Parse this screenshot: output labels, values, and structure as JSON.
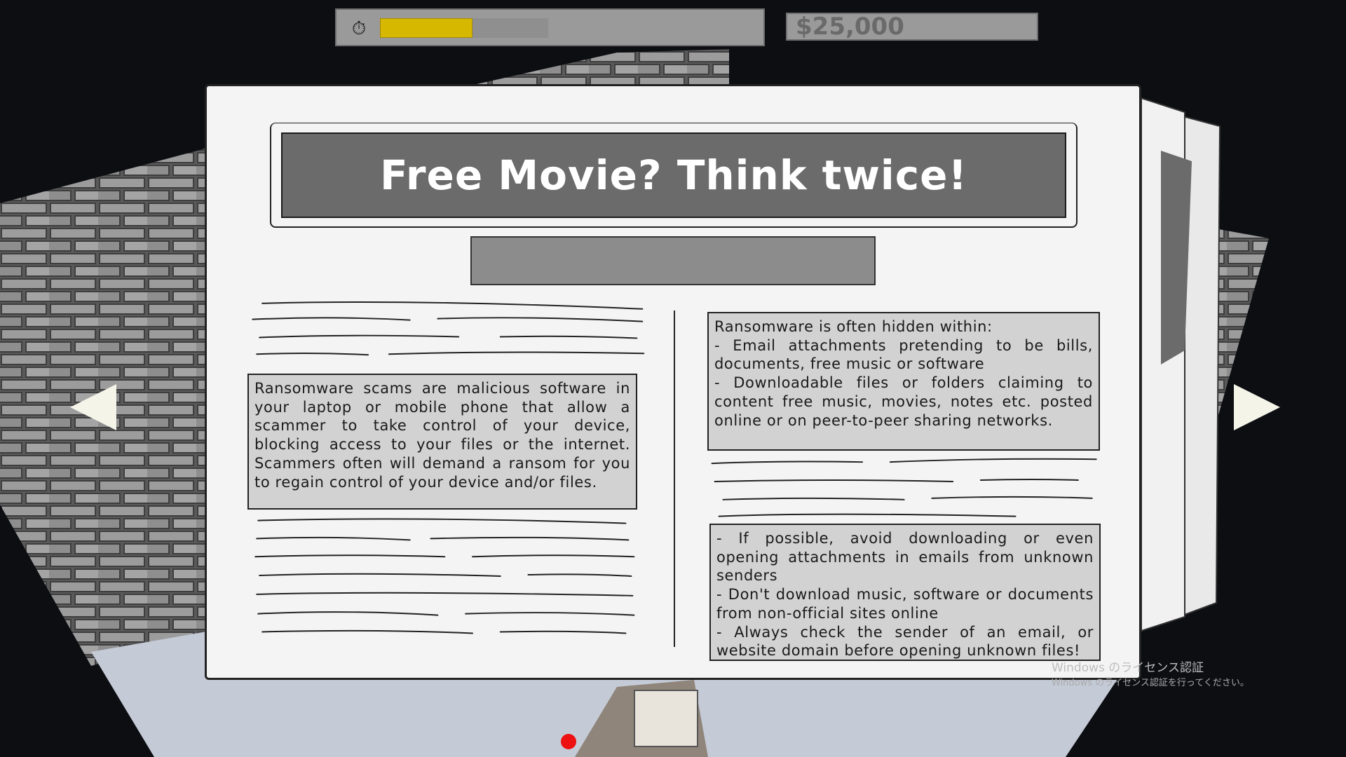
{
  "hud": {
    "timer_icon": "stopwatch-icon",
    "timer_fraction": 0.55,
    "money": "$25,000"
  },
  "newspaper": {
    "headline": "Free Movie? Think twice!",
    "left_text": "Ransomware scams are malicious software in your laptop or mobile phone that allow a scammer to take control of your device, blocking access to your files or the internet. Scammers often will demand a ransom for you to regain control of your device and/or files.",
    "right_top_text": "Ransomware is often hidden within:\n - Email attachments pretending to be bills, documents, free music or software\n - Downloadable files or folders claiming to content free music, movies, notes etc. posted online or on peer-to-peer sharing networks.",
    "right_bottom_text": "- If possible, avoid downloading or even opening attachments in emails from unknown senders\n - Don't download music, software or documents from non-official sites online\n - Always check the sender of an email, or website domain before opening unknown files!"
  },
  "navigation": {
    "prev_icon": "arrow-left-icon",
    "next_icon": "arrow-right-icon"
  },
  "watermark": {
    "title": "Windows のライセンス認証",
    "subtitle": "Windows のライセンス認証を行ってください。"
  },
  "colors": {
    "timer_fill": "#d6b800",
    "paper": "#f4f4f4",
    "headline_bg": "#6b6b6b"
  }
}
